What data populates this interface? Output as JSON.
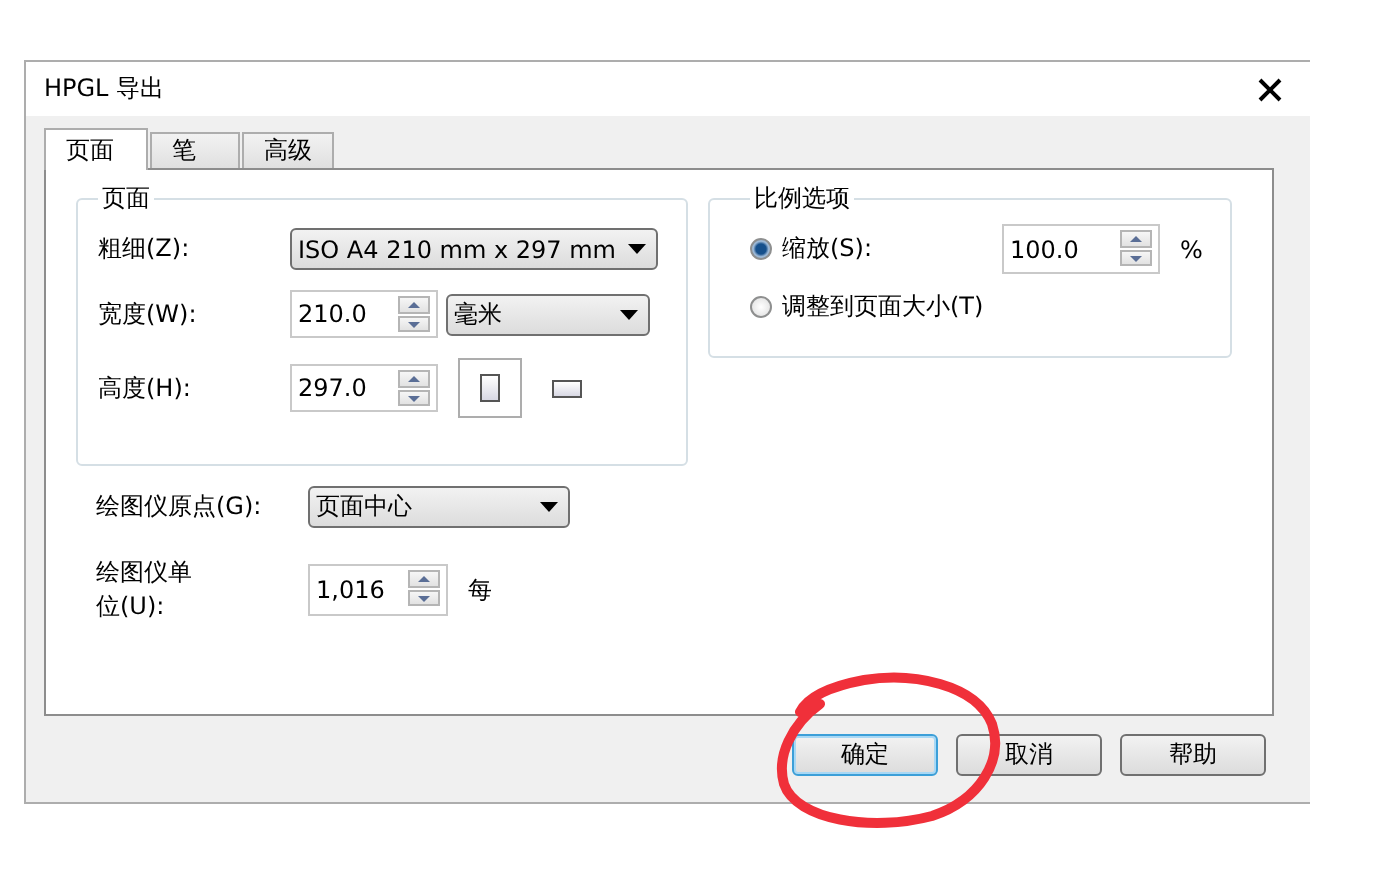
{
  "window": {
    "title": "HPGL 导出"
  },
  "tabs": [
    {
      "label": "页面",
      "selected": true
    },
    {
      "label": "笔",
      "selected": false
    },
    {
      "label": "高级",
      "selected": false
    }
  ],
  "page_group": {
    "title": "页面",
    "paper_size": {
      "label": "粗细(Z):",
      "value": "ISO A4 210 mm x 297 mm"
    },
    "width": {
      "label": "宽度(W):",
      "value": "210.0",
      "unit": "毫米"
    },
    "height": {
      "label": "高度(H):",
      "value": "297.0"
    },
    "orientations": [
      {
        "kind": "portrait",
        "selected": true
      },
      {
        "kind": "landscape",
        "selected": false
      }
    ]
  },
  "scale_group": {
    "title": "比例选项",
    "options": [
      {
        "label": "缩放(S):",
        "selected": true
      },
      {
        "label": "调整到页面大小(T)",
        "selected": false
      }
    ],
    "scale_value": "100.0",
    "unit": "%"
  },
  "origin": {
    "label": "绘图仪原点(G):",
    "value": "页面中心"
  },
  "plotter_units": {
    "label": "绘图仪单位(U):",
    "value": "1,016",
    "suffix": "每"
  },
  "buttons": [
    {
      "label": "确定",
      "focused": true
    },
    {
      "label": "取消",
      "focused": false
    },
    {
      "label": "帮助",
      "focused": false
    }
  ],
  "annotation": {
    "kind": "circle"
  }
}
